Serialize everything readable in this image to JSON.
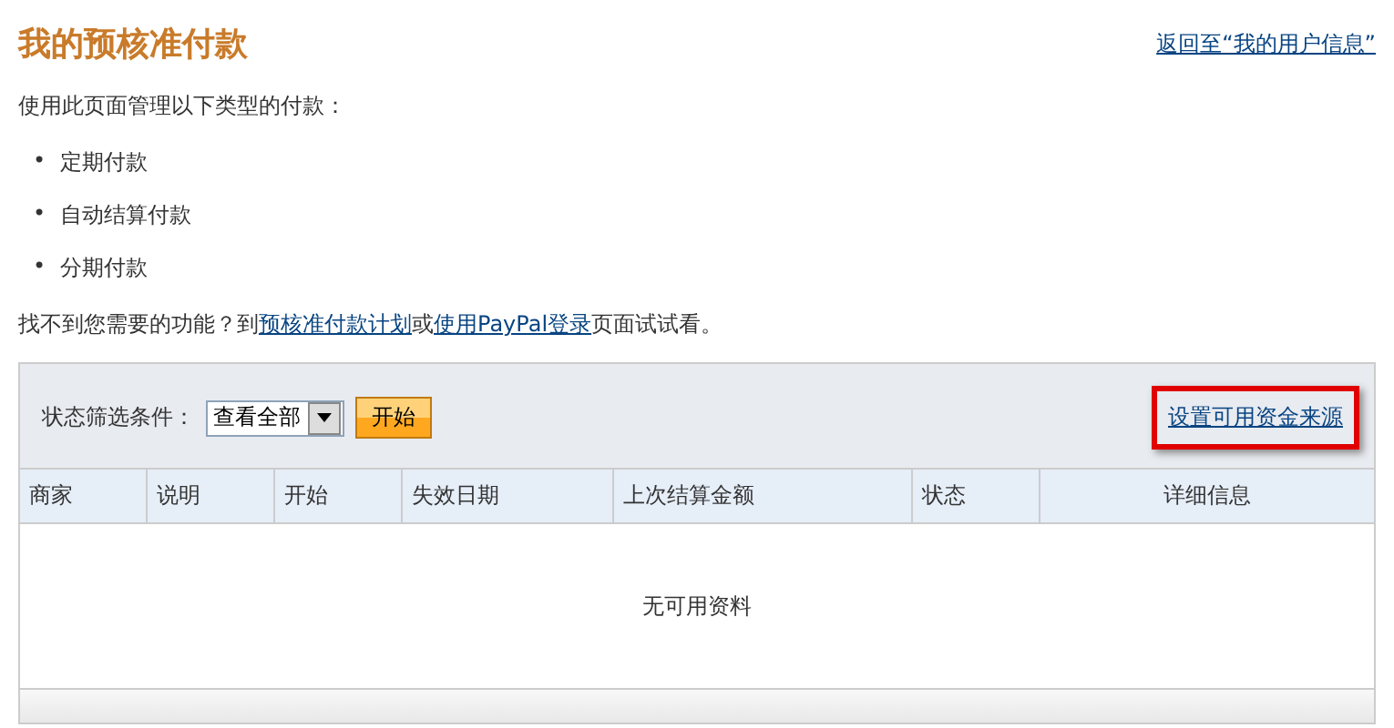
{
  "title": "我的预核准付款",
  "back_link": "返回至“我的用户信息”",
  "intro": "使用此页面管理以下类型的付款：",
  "types": [
    {
      "bullet": "•",
      "text": "定期付款"
    },
    {
      "bullet": "•",
      "text": "自动结算付款"
    },
    {
      "bullet": "•",
      "text": "分期付款"
    }
  ],
  "help": [
    {
      "kind": "text",
      "text": "找不到您需要的功能？到"
    },
    {
      "kind": "link",
      "text": "预核准付款计划"
    },
    {
      "kind": "text",
      "text": "或"
    },
    {
      "kind": "link",
      "text": "使用PayPal登录"
    },
    {
      "kind": "text",
      "text": "页面试试看。"
    }
  ],
  "filter": {
    "label": "状态筛选条件：",
    "value": "查看全部",
    "button": "开始"
  },
  "funding_link": {
    "text": "设置可用资金来源",
    "highlighted": true
  },
  "table": {
    "columns": [
      "商家",
      "说明",
      "开始",
      "失效日期",
      "上次结算金额",
      "状态",
      "详细信息"
    ],
    "empty": "无可用资料"
  }
}
